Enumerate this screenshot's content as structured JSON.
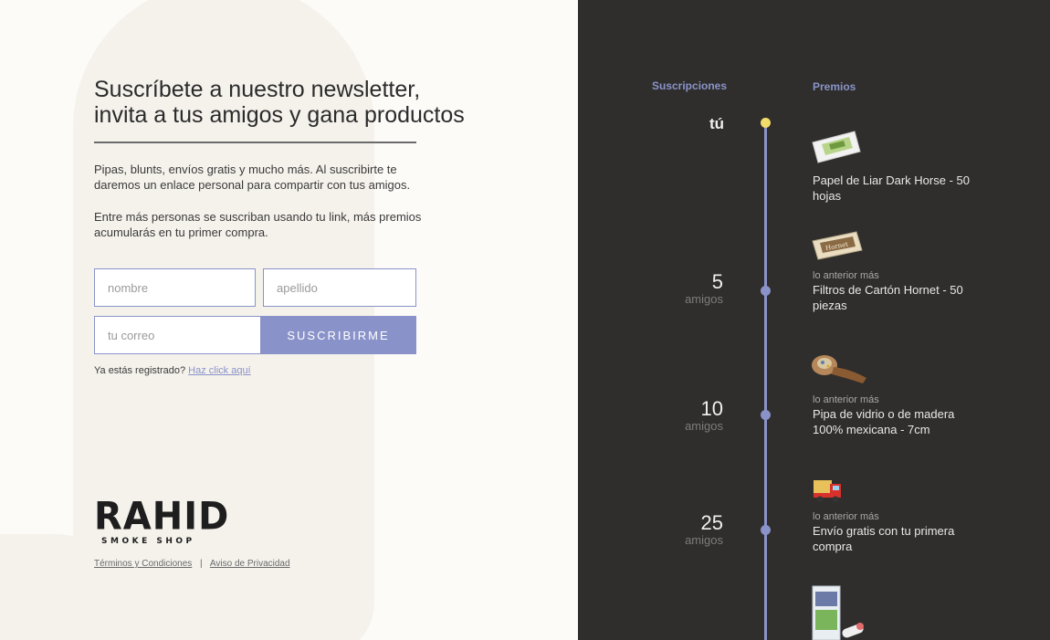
{
  "newsletter": {
    "title_line1": "Suscríbete a nuestro newsletter,",
    "title_line2": "invita a tus amigos y gana productos",
    "desc1": "Pipas, blunts, envíos gratis y mucho más. Al suscribirte te daremos un enlace personal para compartir con tus amigos.",
    "desc2": "Entre más personas se suscriban usando tu link, más premios acumularás en tu primer compra."
  },
  "form": {
    "nombre_placeholder": "nombre",
    "apellido_placeholder": "apellido",
    "correo_placeholder": "tu correo",
    "submit_label": "SUSCRIBIRME",
    "registered_text": "Ya estás registrado?",
    "registered_link": "Haz click aquí"
  },
  "brand": {
    "logo_main": "RAHID",
    "logo_sub": "SMOKE SHOP"
  },
  "footer": {
    "terms": "Términos y Condiciones",
    "separator": "|",
    "privacy": "Aviso de Privacidad"
  },
  "rewards": {
    "subs_header": "Suscripciones",
    "prizes_header": "Premios",
    "you_label": "tú",
    "friends_label": "amigos",
    "prefix": "lo anterior más",
    "tiers": [
      {
        "count": "5",
        "prize": "Filtros de Cartón Hornet - 50 piezas",
        "icon": "filter-tips-icon"
      },
      {
        "count": "10",
        "prize": "Pipa de vidrio o de madera 100% mexicana - 7cm",
        "icon": "pipe-icon"
      },
      {
        "count": "25",
        "prize": "Envío gratis con tu primera compra",
        "icon": "delivery-truck-icon"
      }
    ],
    "base_prize": "Papel de Liar Dark Horse - 50 hojas",
    "base_icon": "rolling-papers-icon",
    "next_icon": "blunt-wraps-icon"
  },
  "colors": {
    "accent": "#8a93c9",
    "you_dot": "#f2dc6b",
    "panel_dark": "#2f2e2c",
    "panel_light": "#fcfbf8"
  }
}
